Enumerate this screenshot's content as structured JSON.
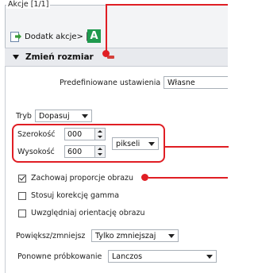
{
  "panel": {
    "legend": "Akcje [1/1]"
  },
  "toolbar": {
    "add_action_label": "Dodatk akcje>",
    "badge": "A"
  },
  "section": {
    "title": "Zmień rozmiar",
    "preset": {
      "label": "Predefiniowane ustawienia",
      "value": "Własne"
    },
    "mode": {
      "label": "Tryb",
      "value": "Dopasuj"
    },
    "width": {
      "label": "Szerokość",
      "value": "000"
    },
    "height": {
      "label": "Wysokość",
      "value": "600"
    },
    "unit": {
      "value": "pikseli"
    },
    "keep_ratio": {
      "label": "Zachowaj proporcje obrazu",
      "checked": true
    },
    "gamma": {
      "label": "Stosuj korekcję gamma",
      "checked": false
    },
    "orientation": {
      "label": "Uwzględniaj orientację obrazu",
      "checked": false
    },
    "enlarge": {
      "label": "Powiększ/zmniejsz",
      "value": "Tylko zmniejszaj"
    },
    "resample": {
      "label": "Ponowne próbkowanie",
      "value": "Lanczos"
    }
  },
  "annotation_color": "#e01e24",
  "icons": [
    "document-add-icon",
    "arrow-right-icon",
    "remove-icon",
    "collapse-triangle-icon",
    "dropdown-arrow-icon"
  ]
}
